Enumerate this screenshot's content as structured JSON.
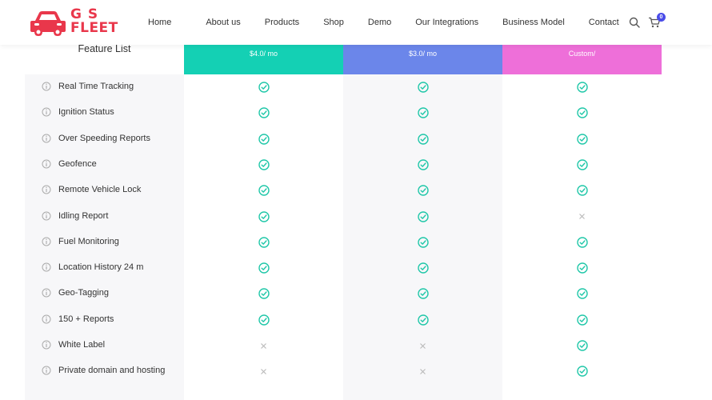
{
  "brand": {
    "line1": "G S",
    "line2": "FLEET",
    "color": "#e9374b"
  },
  "nav": {
    "items": [
      {
        "label": "Home"
      },
      {
        "label": "About us"
      },
      {
        "label": "Products"
      },
      {
        "label": "Shop"
      },
      {
        "label": "Demo"
      },
      {
        "label": "Our Integrations"
      },
      {
        "label": "Business Model"
      },
      {
        "label": "Contact"
      }
    ],
    "cart_count": "0",
    "search_icon": "search-icon",
    "cart_icon": "cart-icon"
  },
  "pricing": {
    "feature_list_title": "Feature List",
    "plans": [
      {
        "price": "$4.0/ mo",
        "color": "#14d0b4"
      },
      {
        "price": "$3.0/ mo",
        "color": "#6b86ea"
      },
      {
        "price": "Custom/",
        "color": "#ee6fd9"
      }
    ],
    "check_color": "#1fc7a8",
    "cross_color": "#b8b8b8",
    "features": [
      {
        "name": "Real Time Tracking",
        "plans": [
          "check",
          "check",
          "check"
        ]
      },
      {
        "name": "Ignition Status",
        "plans": [
          "check",
          "check",
          "check"
        ]
      },
      {
        "name": "Over Speeding Reports",
        "plans": [
          "check",
          "check",
          "check"
        ]
      },
      {
        "name": "Geofence",
        "plans": [
          "check",
          "check",
          "check"
        ]
      },
      {
        "name": "Remote Vehicle Lock",
        "plans": [
          "check",
          "check",
          "check"
        ]
      },
      {
        "name": "Idling Report",
        "plans": [
          "check",
          "check",
          "cross"
        ]
      },
      {
        "name": "Fuel Monitoring",
        "plans": [
          "check",
          "check",
          "check"
        ]
      },
      {
        "name": "Location History 24 m",
        "plans": [
          "check",
          "check",
          "check"
        ]
      },
      {
        "name": "Geo-Tagging",
        "plans": [
          "check",
          "check",
          "check"
        ]
      },
      {
        "name": "150 + Reports",
        "plans": [
          "check",
          "check",
          "check"
        ]
      },
      {
        "name": "White Label",
        "plans": [
          "cross",
          "cross",
          "check"
        ]
      },
      {
        "name": "Private domain and hosting",
        "plans": [
          "cross",
          "cross",
          "check"
        ]
      }
    ]
  }
}
